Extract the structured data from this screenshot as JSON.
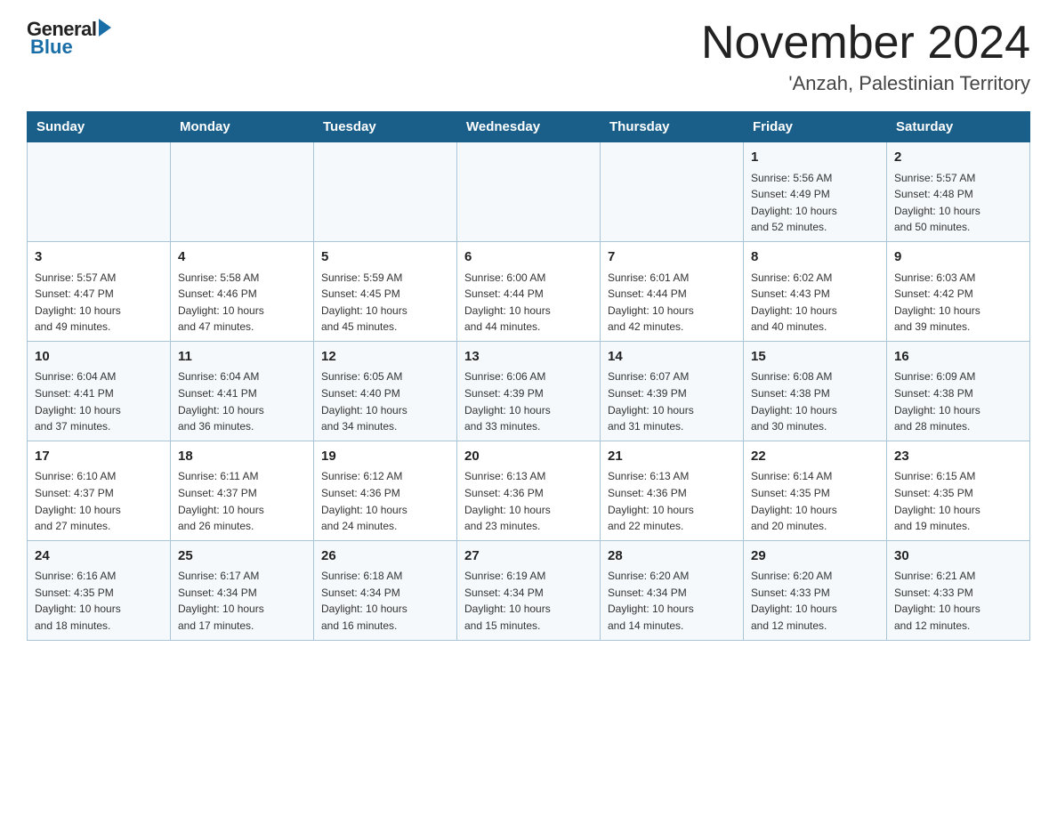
{
  "header": {
    "logo_general": "General",
    "logo_blue": "Blue",
    "title": "November 2024",
    "location": "'Anzah, Palestinian Territory"
  },
  "days_of_week": [
    "Sunday",
    "Monday",
    "Tuesday",
    "Wednesday",
    "Thursday",
    "Friday",
    "Saturday"
  ],
  "weeks": [
    [
      {
        "day": "",
        "info": ""
      },
      {
        "day": "",
        "info": ""
      },
      {
        "day": "",
        "info": ""
      },
      {
        "day": "",
        "info": ""
      },
      {
        "day": "",
        "info": ""
      },
      {
        "day": "1",
        "info": "Sunrise: 5:56 AM\nSunset: 4:49 PM\nDaylight: 10 hours\nand 52 minutes."
      },
      {
        "day": "2",
        "info": "Sunrise: 5:57 AM\nSunset: 4:48 PM\nDaylight: 10 hours\nand 50 minutes."
      }
    ],
    [
      {
        "day": "3",
        "info": "Sunrise: 5:57 AM\nSunset: 4:47 PM\nDaylight: 10 hours\nand 49 minutes."
      },
      {
        "day": "4",
        "info": "Sunrise: 5:58 AM\nSunset: 4:46 PM\nDaylight: 10 hours\nand 47 minutes."
      },
      {
        "day": "5",
        "info": "Sunrise: 5:59 AM\nSunset: 4:45 PM\nDaylight: 10 hours\nand 45 minutes."
      },
      {
        "day": "6",
        "info": "Sunrise: 6:00 AM\nSunset: 4:44 PM\nDaylight: 10 hours\nand 44 minutes."
      },
      {
        "day": "7",
        "info": "Sunrise: 6:01 AM\nSunset: 4:44 PM\nDaylight: 10 hours\nand 42 minutes."
      },
      {
        "day": "8",
        "info": "Sunrise: 6:02 AM\nSunset: 4:43 PM\nDaylight: 10 hours\nand 40 minutes."
      },
      {
        "day": "9",
        "info": "Sunrise: 6:03 AM\nSunset: 4:42 PM\nDaylight: 10 hours\nand 39 minutes."
      }
    ],
    [
      {
        "day": "10",
        "info": "Sunrise: 6:04 AM\nSunset: 4:41 PM\nDaylight: 10 hours\nand 37 minutes."
      },
      {
        "day": "11",
        "info": "Sunrise: 6:04 AM\nSunset: 4:41 PM\nDaylight: 10 hours\nand 36 minutes."
      },
      {
        "day": "12",
        "info": "Sunrise: 6:05 AM\nSunset: 4:40 PM\nDaylight: 10 hours\nand 34 minutes."
      },
      {
        "day": "13",
        "info": "Sunrise: 6:06 AM\nSunset: 4:39 PM\nDaylight: 10 hours\nand 33 minutes."
      },
      {
        "day": "14",
        "info": "Sunrise: 6:07 AM\nSunset: 4:39 PM\nDaylight: 10 hours\nand 31 minutes."
      },
      {
        "day": "15",
        "info": "Sunrise: 6:08 AM\nSunset: 4:38 PM\nDaylight: 10 hours\nand 30 minutes."
      },
      {
        "day": "16",
        "info": "Sunrise: 6:09 AM\nSunset: 4:38 PM\nDaylight: 10 hours\nand 28 minutes."
      }
    ],
    [
      {
        "day": "17",
        "info": "Sunrise: 6:10 AM\nSunset: 4:37 PM\nDaylight: 10 hours\nand 27 minutes."
      },
      {
        "day": "18",
        "info": "Sunrise: 6:11 AM\nSunset: 4:37 PM\nDaylight: 10 hours\nand 26 minutes."
      },
      {
        "day": "19",
        "info": "Sunrise: 6:12 AM\nSunset: 4:36 PM\nDaylight: 10 hours\nand 24 minutes."
      },
      {
        "day": "20",
        "info": "Sunrise: 6:13 AM\nSunset: 4:36 PM\nDaylight: 10 hours\nand 23 minutes."
      },
      {
        "day": "21",
        "info": "Sunrise: 6:13 AM\nSunset: 4:36 PM\nDaylight: 10 hours\nand 22 minutes."
      },
      {
        "day": "22",
        "info": "Sunrise: 6:14 AM\nSunset: 4:35 PM\nDaylight: 10 hours\nand 20 minutes."
      },
      {
        "day": "23",
        "info": "Sunrise: 6:15 AM\nSunset: 4:35 PM\nDaylight: 10 hours\nand 19 minutes."
      }
    ],
    [
      {
        "day": "24",
        "info": "Sunrise: 6:16 AM\nSunset: 4:35 PM\nDaylight: 10 hours\nand 18 minutes."
      },
      {
        "day": "25",
        "info": "Sunrise: 6:17 AM\nSunset: 4:34 PM\nDaylight: 10 hours\nand 17 minutes."
      },
      {
        "day": "26",
        "info": "Sunrise: 6:18 AM\nSunset: 4:34 PM\nDaylight: 10 hours\nand 16 minutes."
      },
      {
        "day": "27",
        "info": "Sunrise: 6:19 AM\nSunset: 4:34 PM\nDaylight: 10 hours\nand 15 minutes."
      },
      {
        "day": "28",
        "info": "Sunrise: 6:20 AM\nSunset: 4:34 PM\nDaylight: 10 hours\nand 14 minutes."
      },
      {
        "day": "29",
        "info": "Sunrise: 6:20 AM\nSunset: 4:33 PM\nDaylight: 10 hours\nand 12 minutes."
      },
      {
        "day": "30",
        "info": "Sunrise: 6:21 AM\nSunset: 4:33 PM\nDaylight: 10 hours\nand 12 minutes."
      }
    ]
  ]
}
